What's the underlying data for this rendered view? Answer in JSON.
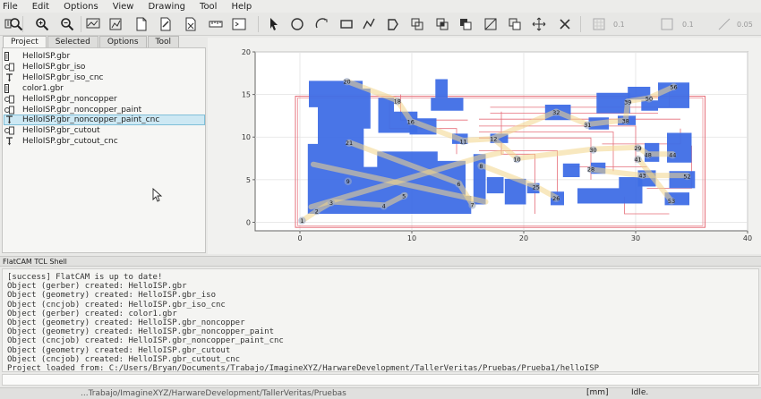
{
  "menubar": {
    "items": [
      "File",
      "Edit",
      "Options",
      "View",
      "Drawing",
      "Tool",
      "Help"
    ]
  },
  "toolbar": {
    "grid_values": [
      "0.1",
      "0.1",
      "0.05"
    ]
  },
  "tabs": [
    "Project",
    "Selected",
    "Options",
    "Tool"
  ],
  "project": {
    "items": [
      {
        "label": "HelloISP.gbr",
        "type": "gerber"
      },
      {
        "label": "HelloISP.gbr_iso",
        "type": "geometry"
      },
      {
        "label": "HelloISP.gbr_iso_cnc",
        "type": "cncjob"
      },
      {
        "label": "color1.gbr",
        "type": "gerber"
      },
      {
        "label": "HelloISP.gbr_noncopper",
        "type": "geometry"
      },
      {
        "label": "HelloISP.gbr_noncopper_paint",
        "type": "geometry"
      },
      {
        "label": "HelloISP.gbr_noncopper_paint_cnc",
        "type": "cncjob",
        "selected": true
      },
      {
        "label": "HelloISP.gbr_cutout",
        "type": "geometry"
      },
      {
        "label": "HelloISP.gbr_cutout_cnc",
        "type": "cncjob"
      }
    ]
  },
  "plot": {
    "x_ticks": [
      "0",
      "10",
      "20",
      "30",
      "40"
    ],
    "y_ticks": [
      "0",
      "5",
      "10",
      "15",
      "20"
    ],
    "x_range": [
      -4,
      40
    ],
    "y_range": [
      -1,
      20
    ],
    "node_labels": [
      {
        "t": "1",
        "x": 0.2,
        "y": 0.2
      },
      {
        "t": "2",
        "x": 1.5,
        "y": 1.3
      },
      {
        "t": "3",
        "x": 2.8,
        "y": 2.3
      },
      {
        "t": "4",
        "x": 7.5,
        "y": 1.9
      },
      {
        "t": "5",
        "x": 9.3,
        "y": 3.1
      },
      {
        "t": "6",
        "x": 14.2,
        "y": 4.5
      },
      {
        "t": "7",
        "x": 15.4,
        "y": 2.0
      },
      {
        "t": "8",
        "x": 16.2,
        "y": 6.6
      },
      {
        "t": "9",
        "x": 4.3,
        "y": 4.8
      },
      {
        "t": "10",
        "x": 19.4,
        "y": 7.4
      },
      {
        "t": "11",
        "x": 14.6,
        "y": 9.5
      },
      {
        "t": "12",
        "x": 17.3,
        "y": 9.8
      },
      {
        "t": "16",
        "x": 9.9,
        "y": 11.8
      },
      {
        "t": "18",
        "x": 8.7,
        "y": 14.2
      },
      {
        "t": "20",
        "x": 4.2,
        "y": 16.5
      },
      {
        "t": "21",
        "x": 4.4,
        "y": 9.3
      },
      {
        "t": "25",
        "x": 21.1,
        "y": 4.1
      },
      {
        "t": "26",
        "x": 22.9,
        "y": 2.8
      },
      {
        "t": "28",
        "x": 26.0,
        "y": 6.2
      },
      {
        "t": "29",
        "x": 30.2,
        "y": 8.7
      },
      {
        "t": "30",
        "x": 26.2,
        "y": 8.5
      },
      {
        "t": "31",
        "x": 25.7,
        "y": 11.4
      },
      {
        "t": "32",
        "x": 22.9,
        "y": 12.9
      },
      {
        "t": "38",
        "x": 29.1,
        "y": 11.9
      },
      {
        "t": "39",
        "x": 29.3,
        "y": 14.1
      },
      {
        "t": "41",
        "x": 30.2,
        "y": 7.4
      },
      {
        "t": "43",
        "x": 30.6,
        "y": 5.5
      },
      {
        "t": "44",
        "x": 33.3,
        "y": 7.9
      },
      {
        "t": "48",
        "x": 31.1,
        "y": 7.9
      },
      {
        "t": "50",
        "x": 31.2,
        "y": 14.5
      },
      {
        "t": "52",
        "x": 34.6,
        "y": 5.4
      },
      {
        "t": "53",
        "x": 33.2,
        "y": 2.5
      },
      {
        "t": "56",
        "x": 33.4,
        "y": 15.9
      }
    ]
  },
  "shell": {
    "title": "FlatCAM TCL Shell",
    "lines": [
      "[success] FlatCAM is up to date!",
      "Object (gerber) created: HelloISP.gbr",
      "Object (geometry) created: HelloISP.gbr_iso",
      "Object (cncjob) created: HelloISP.gbr_iso_cnc",
      "Object (gerber) created: color1.gbr",
      "Object (geometry) created: HelloISP.gbr_noncopper",
      "Object (geometry) created: HelloISP.gbr_noncopper_paint",
      "Object (cncjob) created: HelloISP.gbr_noncopper_paint_cnc",
      "Object (geometry) created: HelloISP.gbr_cutout",
      "Object (cncjob) created: HelloISP.gbr_cutout_cnc",
      "Project loaded from: C:/Users/Bryan/Documents/Trabajo/ImagineXYZ/HarwareDevelopment/TallerVeritas/Pruebas/Prueba1/helloISP"
    ]
  },
  "status": {
    "message": "...Trabajo/ImagineXYZ/HarwareDevelopment/TallerVeritas/Pruebas",
    "units": "[mm]",
    "state": "Idle."
  },
  "colors": {
    "copper_fill": "#3f6ee6",
    "iso_trace": "#e66f7a",
    "cnc_path": "#f3d58a",
    "selection": "#cde8f3"
  }
}
